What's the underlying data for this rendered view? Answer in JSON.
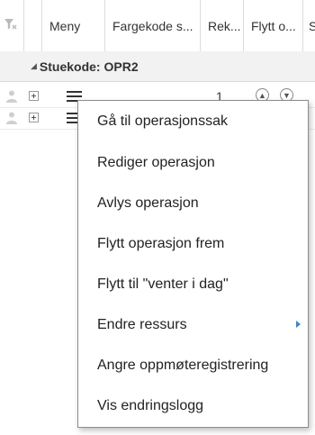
{
  "grid": {
    "columns": [
      {
        "key": "filter",
        "label": ""
      },
      {
        "key": "meny",
        "label": "Meny"
      },
      {
        "key": "fargekode",
        "label": "Fargekode s..."
      },
      {
        "key": "rek",
        "label": "Rek..."
      },
      {
        "key": "flytt",
        "label": "Flytt o..."
      },
      {
        "key": "s",
        "label": "S"
      }
    ],
    "group": {
      "label": "Stuekode: OPR2"
    },
    "rows": [
      {
        "rek": "1"
      },
      {
        "rek": ""
      }
    ]
  },
  "context_menu": {
    "items": [
      {
        "label": "Gå til operasjonssak",
        "has_submenu": false
      },
      {
        "label": "Rediger operasjon",
        "has_submenu": false
      },
      {
        "label": "Avlys operasjon",
        "has_submenu": false
      },
      {
        "label": "Flytt operasjon frem",
        "has_submenu": false
      },
      {
        "label": "Flytt til \"venter i dag\"",
        "has_submenu": false
      },
      {
        "label": "Endre ressurs",
        "has_submenu": true
      },
      {
        "label": "Angre oppmøteregistrering",
        "has_submenu": false
      },
      {
        "label": "Vis endringslogg",
        "has_submenu": false
      }
    ]
  },
  "colors": {
    "submenu_arrow": "#3b87c7",
    "group_background": "#f2f2f2"
  },
  "icons": {
    "filter": "filter-clear-icon",
    "row_person": "person-icon",
    "row_expand": "expand-plus-icon",
    "row_menu": "hamburger-menu-icon",
    "move_up": "arrow-up-circle-icon",
    "move_down": "arrow-down-circle-icon",
    "submenu": "chevron-right-icon"
  }
}
